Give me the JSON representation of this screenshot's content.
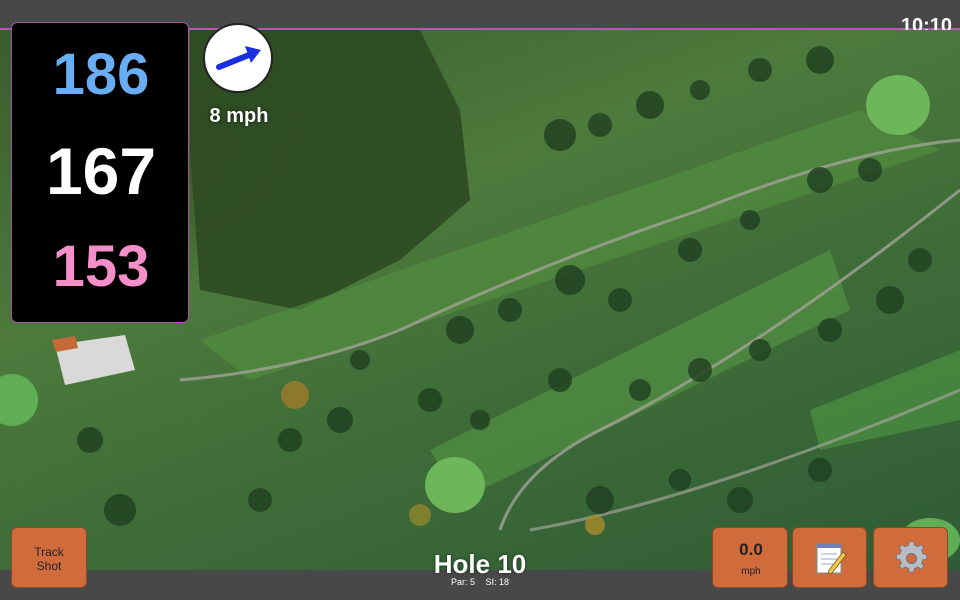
{
  "status": {
    "time": "10:10"
  },
  "distances": {
    "back": "186",
    "center": "167",
    "front": "153",
    "colors": {
      "back": "#69aef4",
      "center": "#ffffff",
      "front": "#f48fc9"
    }
  },
  "wind": {
    "speed_label": "8 mph",
    "arrow_color": "#1a2ee0",
    "speed_color": "#ffffff",
    "icon": "wind-arrow-icon"
  },
  "buttons": {
    "track_shot": {
      "line1": "Track",
      "line2": "Shot"
    },
    "speed": {
      "value": "0.0",
      "unit": "mph"
    },
    "notes": {
      "icon": "notepad-icon"
    },
    "settings": {
      "icon": "gear-icon"
    },
    "color": "#d06b3c"
  },
  "hole": {
    "title": "Hole 10",
    "par": "Par: 5",
    "stroke_index": "SI: 18"
  }
}
